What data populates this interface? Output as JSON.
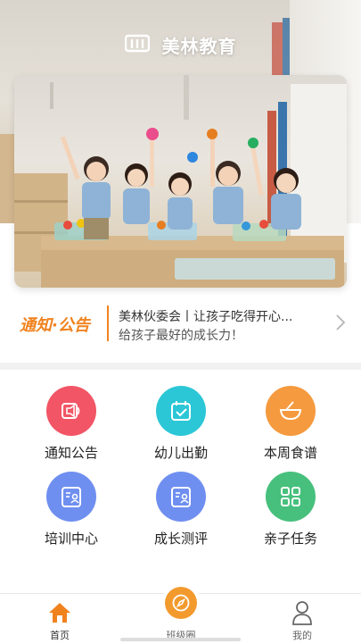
{
  "app": {
    "brand": "美林教育"
  },
  "notice": {
    "title": "通知·公告",
    "line1": "美林伙委会丨让孩子吃得开心...",
    "line2": "给孩子最好的成长力！"
  },
  "features": [
    {
      "label": "通知公告",
      "icon": "speaker-icon",
      "color": "#f25566"
    },
    {
      "label": "幼儿出勤",
      "icon": "calendar-check-icon",
      "color": "#2cc7d6"
    },
    {
      "label": "本周食谱",
      "icon": "bowl-icon",
      "color": "#f59a3e"
    },
    {
      "label": "培训中心",
      "icon": "id-card-icon",
      "color": "#6f8ff0"
    },
    {
      "label": "成长测评",
      "icon": "id-card-icon",
      "color": "#6f8ff0"
    },
    {
      "label": "亲子任务",
      "icon": "grid-icon",
      "color": "#48c07d"
    }
  ],
  "tabbar": {
    "items": [
      {
        "label": "首页",
        "icon": "home-icon",
        "active": true
      },
      {
        "label": "班级圈",
        "icon": "compass-icon",
        "active": false
      },
      {
        "label": "我的",
        "icon": "user-icon",
        "active": false
      }
    ],
    "accent": "#f0821e"
  }
}
